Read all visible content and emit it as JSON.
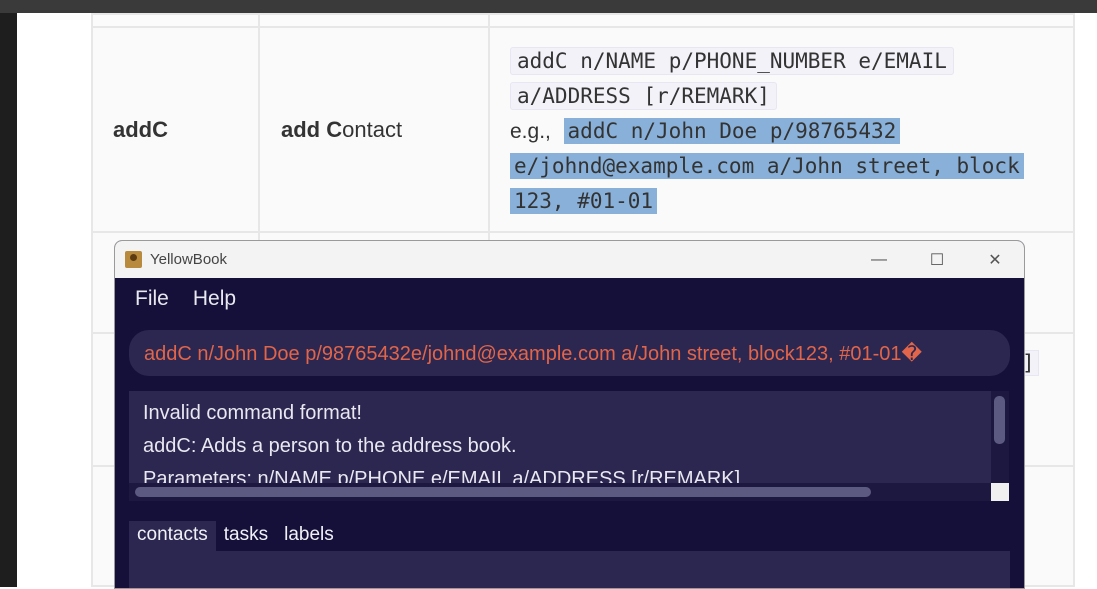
{
  "doc": {
    "command": "addC",
    "action_bold_1": "add C",
    "action_rest_1": "ontact",
    "format_line1": "addC n/NAME p/PHONE_NUMBER e/EMAIL",
    "format_line2": "a/ADDRESS [r/REMARK]",
    "eg_label": "e.g.,",
    "example_line1": "addC n/John Doe p/98765432",
    "example_line2": "e/johnd@example.com a/John street, block",
    "example_line3": "123, #01-01",
    "stray_bracket": "]"
  },
  "window": {
    "title": "YellowBook",
    "minimize_symbol": "—",
    "maximize_symbol": "☐",
    "close_symbol": "✕",
    "icon": "address-book-icon"
  },
  "menu": {
    "file": "File",
    "help": "Help"
  },
  "command_input": {
    "value": "addC n/John Doe p/98765432e/johnd@example.com a/John street, block123, #01-01�"
  },
  "result": {
    "text": "Invalid command format!\naddC: Adds a person to the address book.\nParameters: n/NAME p/PHONE e/EMAIL a/ADDRESS [r/REMARK]"
  },
  "tabs": [
    {
      "label": "contacts",
      "active": true
    },
    {
      "label": "tasks",
      "active": false
    },
    {
      "label": "labels",
      "active": false
    }
  ],
  "colors": {
    "window_bg": "#14103a",
    "panel_bg": "#2c2750",
    "error_text": "#e0654a",
    "selection": "#88b0d8"
  }
}
